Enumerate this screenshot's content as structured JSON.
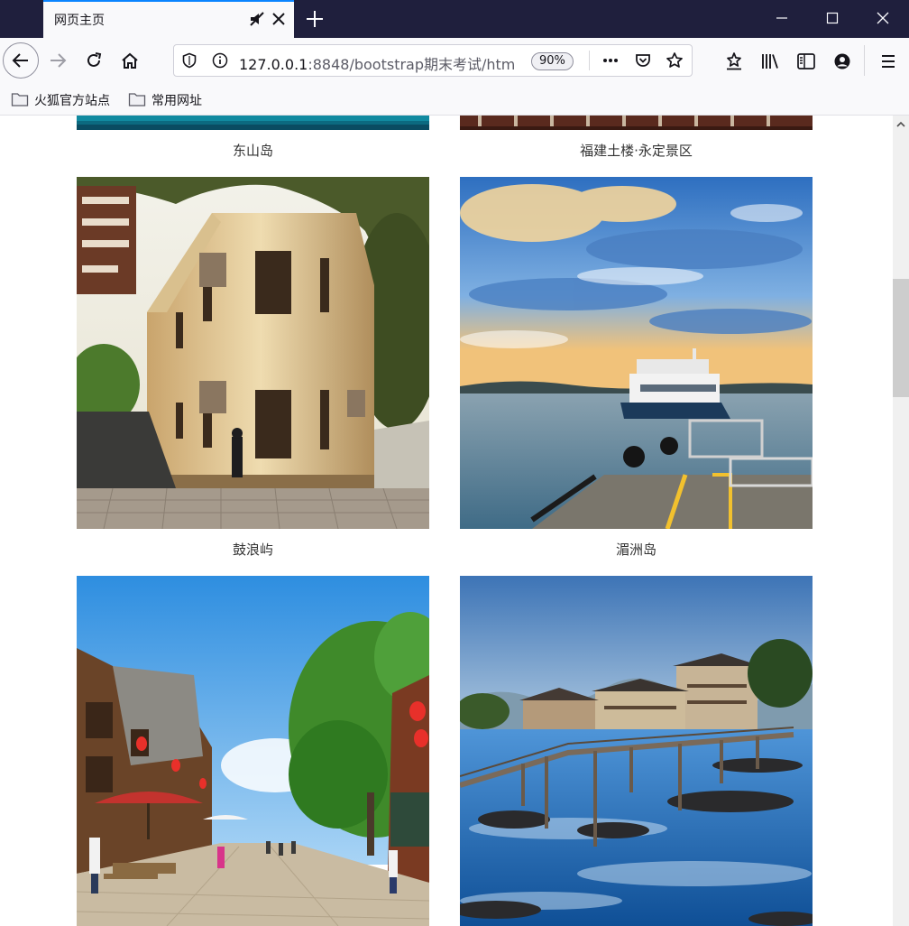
{
  "browser": {
    "tab_title": "网页主页",
    "url_host": "127.0.0.1",
    "url_rest": ":8848/bootstrap期末考试/htm",
    "zoom": "90%"
  },
  "bookmarks": [
    {
      "label": "火狐官方站点"
    },
    {
      "label": "常用网址"
    }
  ],
  "gallery": {
    "captions": [
      "东山岛",
      "福建土楼·永定景区",
      "鼓浪屿",
      "湄洲岛"
    ]
  }
}
